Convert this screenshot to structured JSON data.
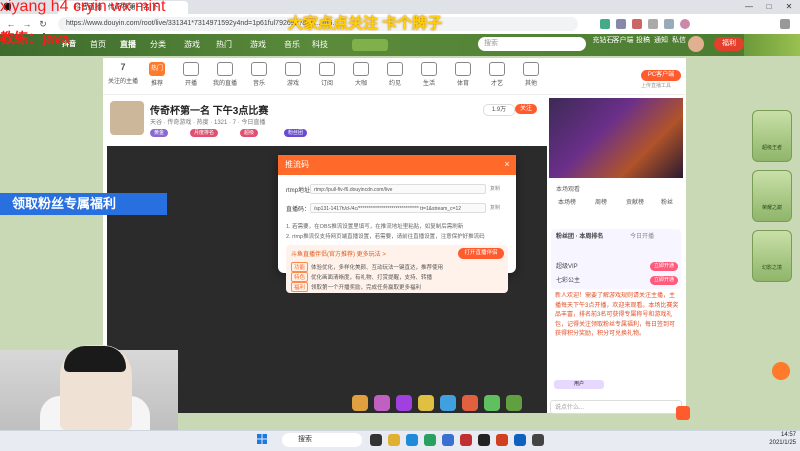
{
  "browser": {
    "tab_title": "抖音直播 | 传奇杯第一名 下",
    "url": "https://www.douyin.com/root/live/331341*7314971592y4nd=1p61ful792692?&4u...ud6..",
    "win_min": "—",
    "win_max": "□",
    "win_close": "✕"
  },
  "overlays": {
    "line1": "xiyang h4 cryin wx mint",
    "line2": "教练：java",
    "banner_top": "大家点点关注 卡个牌子",
    "blue_banner": "领取粉丝专属福利"
  },
  "site": {
    "logo": "抖音",
    "nav": [
      "首页",
      "直播",
      "分类",
      "游戏",
      "热门",
      "游戏",
      "音乐",
      "科技"
    ],
    "search_placeholder": "搜索",
    "top_icons": [
      "充钻石",
      "客户端",
      "投稿",
      "通知",
      "私信"
    ],
    "top_badge": "福利"
  },
  "categories": [
    {
      "label": "7",
      "sub": "关注的主播"
    },
    {
      "label": "热门",
      "sub": "推荐"
    },
    {
      "label": "开播",
      "sub": ""
    },
    {
      "label": "我的直播",
      "sub": ""
    },
    {
      "label": "音乐",
      "sub": ""
    },
    {
      "label": "游戏",
      "sub": ""
    },
    {
      "label": "订阅",
      "sub": ""
    },
    {
      "label": "大咖",
      "sub": ""
    },
    {
      "label": "约见",
      "sub": ""
    },
    {
      "label": "生活",
      "sub": ""
    },
    {
      "label": "体育",
      "sub": ""
    },
    {
      "label": "才艺",
      "sub": ""
    },
    {
      "label": "其他",
      "sub": ""
    }
  ],
  "pc_button": "PC客户端",
  "pc_sub": "上传直播工具",
  "stream": {
    "title": "传奇杯第一名 下午3点比赛",
    "meta": "天谷 · 传奇游戏 · 热度 · 1321 · 7 · 今日直播",
    "followers": "1.9万",
    "follow_label": "关注",
    "badges": [
      "黄金",
      "月度排名",
      "超级",
      "粉丝团"
    ]
  },
  "dialog": {
    "title": "推流码",
    "server_label": "rtmp地址：",
    "server_value": "rtmp://pull-flv-f6.douyincdn.com/live",
    "key_label": "直播码：",
    "key_value": "/sp131-1417h/d-/4c/******************************* tt=1&stream_c=12",
    "copy1": "复制",
    "copy2": "复制",
    "tip1": "1. 若需要，在OBS推流设置里填写，在推流地址里粘贴，如复制后需刷新",
    "tip2": "2. rtmp推流仅支持网页端直播设置，若需要，请前往直播设置，注意保护好推流码",
    "promo_title": "斗鱼直播伴侣(官方推荐) 更多玩法 >",
    "open_btn": "打开直播伴侣",
    "rows": [
      {
        "tag": "功能",
        "text": "体验优化，多样化美颜、互动玩法一键直达，推荐使用"
      },
      {
        "tag": "特色",
        "text": "优化画面清晰度，有礼物、打赏提醒，支持、转播"
      },
      {
        "tag": "福利",
        "text": "领取第一个开播奖励，完成任务赢取更多福利"
      }
    ]
  },
  "right": {
    "tabs": [
      "本场榜",
      "周榜",
      "贡献榜",
      "粉丝"
    ],
    "status": "本场观看",
    "rank_title": "粉丝团 · 本周排名",
    "rank_sub": "今日开播",
    "rank_rows": [
      {
        "name": "超级VIP",
        "btn": "立即开通"
      },
      {
        "name": "七彩公主",
        "btn": "立即开通"
      }
    ],
    "orange_text": "新人欢迎！需要了解游戏规则请关注主播，主播每天下午3点开播，欢迎来观看。本场比赛奖品丰富，排名前3名可获得专属称号和游戏礼包，记得关注领取粉丝专属福利，每日签到可获得积分奖励，积分可兑换礼物。",
    "chat_placeholder": "说点什么...",
    "user_tag": "用户"
  },
  "taskbar": {
    "search": "搜索",
    "time": "14:57",
    "date": "2021/1/25"
  },
  "deco": [
    "超级王者",
    "荣耀之巅",
    "幻影之境"
  ]
}
